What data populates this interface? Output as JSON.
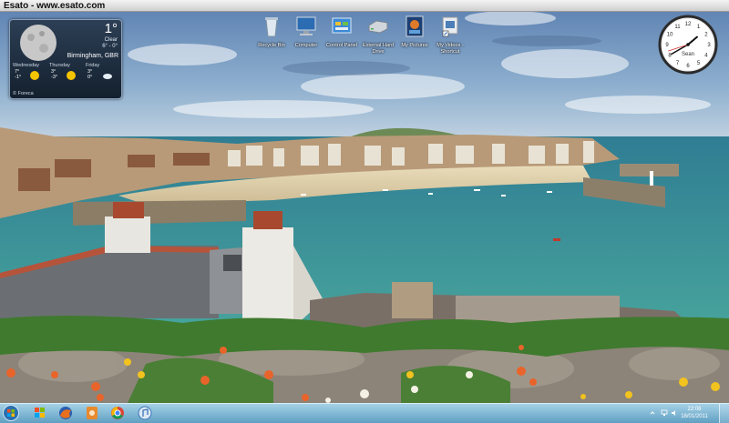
{
  "window_title": "Esato - www.esato.com",
  "weather": {
    "temperature": "1°",
    "condition": "Clear",
    "range": "6° - 0°",
    "location": "Birmingham, GBR",
    "forecast": [
      {
        "day": "Wednesday",
        "high": "7°",
        "low": "-1°",
        "icon": "sun-icon"
      },
      {
        "day": "Thursday",
        "high": "3°",
        "low": "-3°",
        "icon": "sun-icon"
      },
      {
        "day": "Friday",
        "high": "3°",
        "low": "0°",
        "icon": "cloud-icon"
      }
    ],
    "source": "© Foreca"
  },
  "desktop_icons": [
    {
      "label": "Recycle Bin",
      "icon": "recycle-bin-icon"
    },
    {
      "label": "Computer",
      "icon": "computer-icon"
    },
    {
      "label": "Control Panel",
      "icon": "control-panel-icon"
    },
    {
      "label": "External Hard Drive",
      "icon": "hard-drive-icon"
    },
    {
      "label": "My Pictures",
      "icon": "pictures-icon"
    },
    {
      "label": "My Videos - Shortcut",
      "icon": "videos-shortcut-icon"
    }
  ],
  "clock": {
    "label": "Sean",
    "hour": 1,
    "minute": 40,
    "second": 42
  },
  "taskbar": {
    "pinned": [
      {
        "name": "windows-media-player-icon"
      },
      {
        "name": "firefox-icon"
      },
      {
        "name": "media-app-icon"
      },
      {
        "name": "chrome-icon"
      },
      {
        "name": "itunes-icon"
      }
    ],
    "time": "22:08",
    "date": "18/01/2011"
  },
  "colors": {
    "taskbar": "#7fbad6",
    "sea": "#3f9a98",
    "sky": "#6a8fb8"
  }
}
